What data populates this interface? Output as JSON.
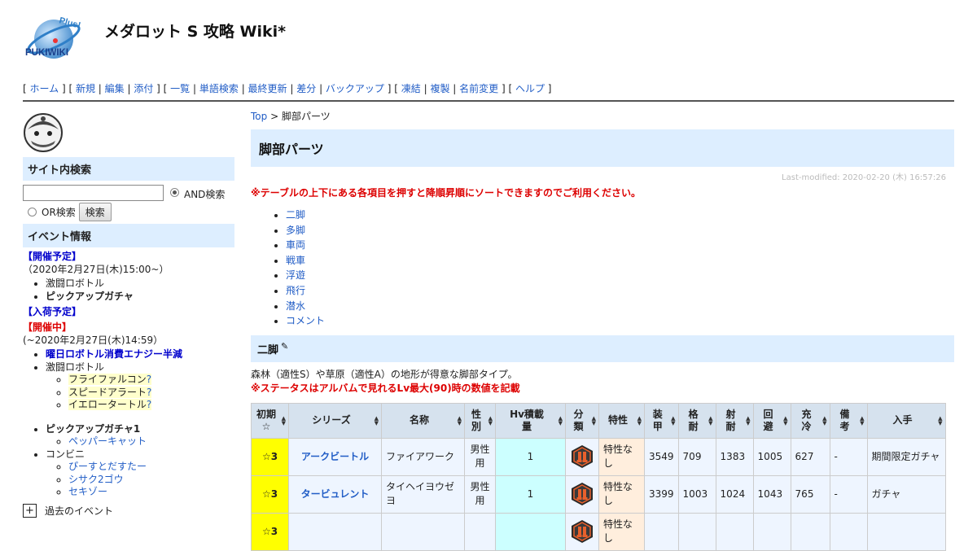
{
  "site": {
    "title": "メダロット S 攻略 Wiki*",
    "logo_text": "PUKIWIKI",
    "logo_sub": "Plus!"
  },
  "nav": [
    [
      "ホーム",
      "新規",
      "編集",
      "添付"
    ],
    [
      "一覧",
      "単語検索",
      "最終更新",
      "差分",
      "バックアップ"
    ],
    [
      "凍結",
      "複製",
      "名前変更"
    ],
    [
      "ヘルプ"
    ]
  ],
  "sidebar": {
    "search_heading": "サイト内検索",
    "search_value": "",
    "and_label": "AND検索",
    "or_label": "OR検索",
    "search_button": "検索",
    "event_heading": "イベント情報",
    "scheduled_heading": "【開催予定】",
    "scheduled_date": "（2020年2月27日(木)15:00~）",
    "scheduled_items": [
      "激闘ロボトル",
      "ピックアップガチャ"
    ],
    "arrival_heading": "【入荷予定】",
    "ongoing_heading": "【開催中】",
    "ongoing_date": "(~2020年2月27日(木)14:59）",
    "ongoing_item1": "曜日ロボトル消費エナジー半減",
    "ongoing_item2": "激闘ロボトル",
    "ongoing_sub": [
      "フライファルコン",
      "スピードアラート",
      "イエロータートル"
    ],
    "q_mark": "?",
    "pickup": "ピックアップガチャ1",
    "pickup_sub": [
      "ペッパーキャット"
    ],
    "convenience": "コンビニ",
    "convenience_sub": [
      "ぴーすとだすたー",
      "シサク2ゴウ",
      "セキゾー"
    ],
    "past_events": "過去のイベント",
    "plus": "+"
  },
  "main": {
    "breadcrumb_top": "Top",
    "breadcrumb_sep": " > ",
    "breadcrumb_current": "脚部パーツ",
    "title": "脚部パーツ",
    "last_modified": "Last-modified: 2020-02-20 (木) 16:57:26",
    "notice": "※テーブルの上下にある各項目を押すと降順昇順にソートできますのでご利用ください。",
    "toc": [
      "二脚",
      "多脚",
      "車両",
      "戦車",
      "浮遊",
      "飛行",
      "潜水",
      "コメント"
    ],
    "section_title": "二脚",
    "section_desc": "森林（適性S）や草原（適性A）の地形が得意な脚部タイプ。",
    "section_note": "※ステータスはアルバムで見れるLv最大(90)時の数値を記載"
  },
  "table": {
    "headers": [
      "初期\n☆",
      "シリーズ",
      "名称",
      "性\n別",
      "Hv積載\n量",
      "分\n類",
      "特性",
      "装\n甲",
      "格\n耐",
      "射\n耐",
      "回\n避",
      "充\n冷",
      "備\n考",
      "入手"
    ],
    "rows": [
      {
        "rarity": "☆3",
        "series": "アークビートル",
        "name": "ファイアワーク",
        "gender": "男性用",
        "hv": "1",
        "feature": "特性なし",
        "armor": "3549",
        "melee": "709",
        "shoot": "1383",
        "evade": "1005",
        "cool": "627",
        "note": "-",
        "obtain": "期間限定ガチャ"
      },
      {
        "rarity": "☆3",
        "series": "タービュレント",
        "name": "タイヘイヨウゼヨ",
        "gender": "男性用",
        "hv": "1",
        "feature": "特性なし",
        "armor": "3399",
        "melee": "1003",
        "shoot": "1024",
        "evade": "1043",
        "cool": "765",
        "note": "-",
        "obtain": "ガチャ"
      },
      {
        "rarity": "☆3",
        "series": "",
        "name": "",
        "gender": "",
        "hv": "",
        "feature": "特性なし",
        "armor": "",
        "melee": "",
        "shoot": "",
        "evade": "",
        "cool": "",
        "note": "",
        "obtain": ""
      }
    ]
  },
  "colors": {
    "header_bg": "#ddeeff",
    "rarity_bg": "#ffff00",
    "link": "#215dc6",
    "notice": "#dd0000"
  }
}
